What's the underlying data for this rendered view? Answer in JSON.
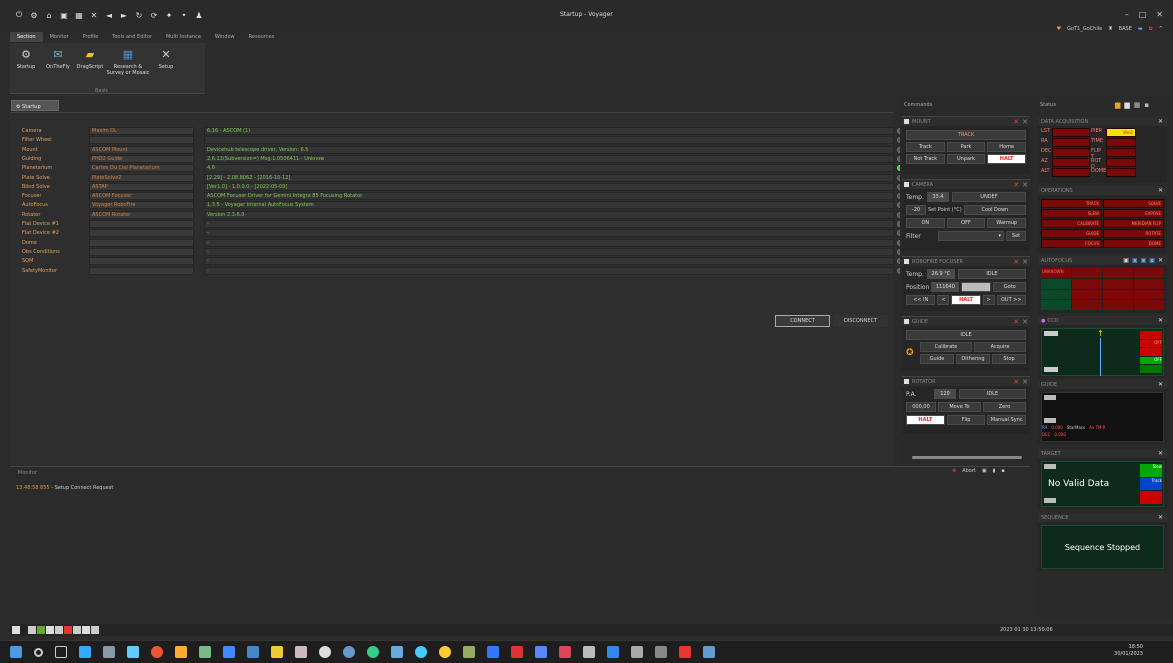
{
  "window": {
    "title": "Startup - Voyager"
  },
  "menus": [
    {
      "label": "Section",
      "active": true
    },
    {
      "label": "Monitor"
    },
    {
      "label": "Profile"
    },
    {
      "label": "Tools and Editor"
    },
    {
      "label": "Multi Instance"
    },
    {
      "label": "Window"
    },
    {
      "label": "Resources"
    }
  ],
  "user": {
    "name": "GoT1_GoChile",
    "base_label": "BASE"
  },
  "ribbon": {
    "buttons": [
      {
        "label": "Startup",
        "icon": "gear-icon",
        "color": "#cfcfcf"
      },
      {
        "label": "OnTheFly",
        "icon": "envelope-icon",
        "color": "#7ab0d0"
      },
      {
        "label": "DragScript",
        "icon": "folder-icon",
        "color": "#f0c030"
      },
      {
        "label": "Research & Survey or Mosaic",
        "icon": "grid-icon",
        "color": "#4a8ac8"
      },
      {
        "label": "Setup",
        "icon": "tools-icon",
        "color": "#cccccc"
      }
    ],
    "group_label": "Basic"
  },
  "tabs": {
    "startup": "Startup"
  },
  "devices": [
    {
      "name": "Camera",
      "driver": "Maxim DL",
      "info": "6.16 - ASCOM (1)"
    },
    {
      "name": "Filter Wheel",
      "driver": "",
      "info": ""
    },
    {
      "name": "Mount",
      "driver": "ASCOM Mount",
      "info": "Devicehub telescope driver, Version: 6.5"
    },
    {
      "name": "Guiding",
      "driver": "PHD2 Guide",
      "info": "2.6.11(Subversion=) Msg:1.0506411 - Unknow"
    },
    {
      "name": "Planetarium",
      "driver": "Cartes Du Ciel Planetarium",
      "info": "4.6"
    },
    {
      "name": "Plate Solve",
      "driver": "PlateSolve2",
      "info": "[2.29] - 2.08.8062 - [2016-10-12]"
    },
    {
      "name": "Blind Solve",
      "driver": "ASTAP",
      "info": "[Ver1.0] - 1.0.0.0 - [2022-05-09]"
    },
    {
      "name": "Focuser",
      "driver": "ASCOM Focuser",
      "info": "ASCOM Focuser Driver for Gemini Integra 85 Focusing Rotator"
    },
    {
      "name": "AutoFocus",
      "driver": "Voyager RoboFire",
      "info": "1.3.5 - Voyager Internal AutoFocus System"
    },
    {
      "name": "Rotator",
      "driver": "ASCOM Rotator",
      "info": "Version 2.3.6.0"
    },
    {
      "name": "Flat Device #1",
      "driver": "",
      "info": "-"
    },
    {
      "name": "Flat Device #2",
      "driver": "",
      "info": "-"
    },
    {
      "name": "Dome",
      "driver": "",
      "info": "-"
    },
    {
      "name": "Obs Conditions",
      "driver": "",
      "info": "-"
    },
    {
      "name": "SQM",
      "driver": "",
      "info": "-"
    },
    {
      "name": "SafetyMonitor",
      "driver": "",
      "info": "-"
    }
  ],
  "actions": {
    "connect": "CONNECT",
    "disconnect": "DISCONNECT"
  },
  "monitor": {
    "title": "Monitor",
    "time": "13:48:58 855",
    "message": " - Setup Connect Request",
    "abort_label": "Abort"
  },
  "commands": {
    "title": "Commands",
    "mount": {
      "title": "MOUNT",
      "state": "TRACK",
      "b1": "Track",
      "b2": "Park",
      "b3": "Home",
      "b4": "Not Track",
      "b5": "Unpark",
      "b6": "HALT"
    },
    "camera": {
      "title": "CAMERA",
      "temp_label": "Temp.",
      "temp": "33.4",
      "state": "UNDEF",
      "setpoint": "-20",
      "set_label": "Set Point (°C)",
      "cool": "Cool Down",
      "on": "ON",
      "off": "OFF",
      "warmup": "Warmup",
      "filter_label": "Filter",
      "set": "Set"
    },
    "focuser": {
      "title": "ROBOFIRE FOCUSER",
      "temp_label": "Temp.",
      "temp": "26.9 °C",
      "state": "IDLE",
      "pos_label": "Position",
      "position": "111640",
      "goto": "Goto",
      "in": "<< IN",
      "lt": "<",
      "halt": "HALT",
      "gt": ">",
      "out": "OUT >>"
    },
    "guide": {
      "title": "GUIDE",
      "state": "IDLE",
      "calibrate": "Calibrate",
      "acquire": "Acquire",
      "guide": "Guide",
      "dither": "Dithering",
      "stop": "Stop"
    },
    "rotator": {
      "title": "ROTATOR",
      "pa_label": "P.A.",
      "pa": "120",
      "state": "IDLE",
      "val": "000,00",
      "moveto": "Move To",
      "zero": "Zero",
      "halt": "HALT",
      "flip": "Flip",
      "manual": "Manual Sync"
    }
  },
  "status": {
    "title": "Status",
    "data_acq": {
      "title": "DATA ACQUISITION",
      "lst": "LST",
      "ra": "RA",
      "dec": "DEC",
      "az": "AZ",
      "alt": "ALT",
      "pier": "PIER",
      "pier_val": "West",
      "time": "TIME",
      "flip": "FLIP T",
      "rotd": "ROT D",
      "dome": "DOME"
    },
    "operations": {
      "title": "OPERATIONS",
      "items": [
        "TRACK",
        "SOLVE",
        "SLEW",
        "EXPOSE",
        "CALIBRATE",
        "MERIDIAN FLIP",
        "GUIDE",
        "ROTATE",
        "FOCUS",
        "DOME"
      ]
    },
    "autofocus": {
      "title": "AUTOFOCUS",
      "label": "UNKNOWN"
    },
    "ccd": {
      "title": "CCD",
      "t1": "OFF",
      "t2": "OFF"
    },
    "guide": {
      "title": "GUIDE",
      "ra": "RA",
      "dec": "DEC",
      "ra_val": "0.000",
      "dec_val": "0.000",
      "starmass": "StarMass",
      "rms": "Ax TM:R"
    },
    "target": {
      "title": "TARGET",
      "nodata": "No Valid Data",
      "b1": "Slew",
      "b2": "Track"
    },
    "sequence": {
      "title": "SEQUENCE",
      "text": "Sequence Stopped"
    }
  },
  "bottom": {
    "datetime": "2023 01 30   13:50:06"
  },
  "taskbar": {
    "time": "18:50",
    "date": "30/01/2023"
  }
}
